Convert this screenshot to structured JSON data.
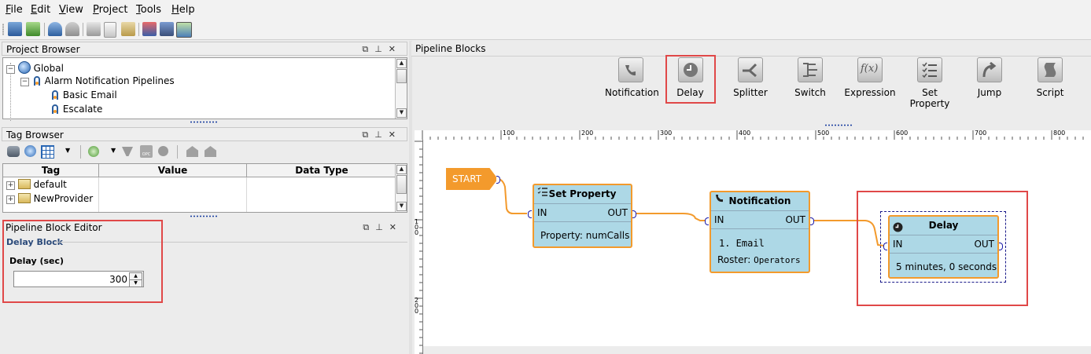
{
  "menu": {
    "items": [
      {
        "u": "F",
        "rest": "ile"
      },
      {
        "u": "E",
        "rest": "dit"
      },
      {
        "u": "V",
        "rest": "iew"
      },
      {
        "u": "P",
        "rest": "roject"
      },
      {
        "u": "T",
        "rest": "ools"
      },
      {
        "u": "H",
        "rest": "elp"
      }
    ]
  },
  "project_browser": {
    "title": "Project Browser",
    "items": [
      "Global",
      "Alarm Notification Pipelines",
      "Basic Email",
      "Escalate"
    ]
  },
  "tag_browser": {
    "title": "Tag Browser",
    "columns": [
      "Tag",
      "Value",
      "Data Type"
    ],
    "rows": [
      {
        "tag": "default"
      },
      {
        "tag": "NewProvider"
      }
    ]
  },
  "editor": {
    "title": "Pipeline Block Editor",
    "section": "Delay Block",
    "field_label": "Delay (sec)",
    "field_value": "300"
  },
  "palette": {
    "title": "Pipeline Blocks",
    "items": [
      "Notification",
      "Delay",
      "Splitter",
      "Switch",
      "Expression",
      "Set Property",
      "Jump",
      "Script"
    ],
    "selected": "Delay"
  },
  "ruler": {
    "ticks": [
      "100",
      "200",
      "300",
      "400",
      "500",
      "600",
      "700",
      "800"
    ],
    "vticks": [
      "100",
      "200"
    ]
  },
  "canvas": {
    "start_label": "START",
    "blocks": {
      "set_property": {
        "title": "Set Property",
        "in": "IN",
        "out": "OUT",
        "body": "Property: numCalls"
      },
      "notification": {
        "title": "Notification",
        "in": "IN",
        "out": "OUT",
        "line1": "1. Email",
        "line2_label": "Roster:",
        "line2_value": "Operators"
      },
      "delay": {
        "title": "Delay",
        "in": "IN",
        "out": "OUT",
        "body": "5 minutes, 0 seconds"
      }
    }
  },
  "colors": {
    "accent_red": "#e04848",
    "block_fill": "#add8e6",
    "block_border": "#f39a2c",
    "start_fill": "#f39a2c"
  }
}
